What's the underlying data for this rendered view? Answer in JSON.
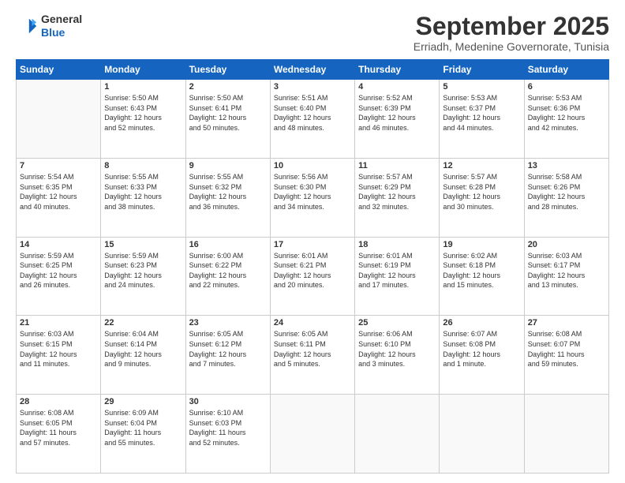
{
  "logo": {
    "line1": "General",
    "line2": "Blue"
  },
  "title": "September 2025",
  "location": "Erriadh, Medenine Governorate, Tunisia",
  "days_of_week": [
    "Sunday",
    "Monday",
    "Tuesday",
    "Wednesday",
    "Thursday",
    "Friday",
    "Saturday"
  ],
  "weeks": [
    [
      {
        "day": "",
        "info": ""
      },
      {
        "day": "1",
        "info": "Sunrise: 5:50 AM\nSunset: 6:43 PM\nDaylight: 12 hours\nand 52 minutes."
      },
      {
        "day": "2",
        "info": "Sunrise: 5:50 AM\nSunset: 6:41 PM\nDaylight: 12 hours\nand 50 minutes."
      },
      {
        "day": "3",
        "info": "Sunrise: 5:51 AM\nSunset: 6:40 PM\nDaylight: 12 hours\nand 48 minutes."
      },
      {
        "day": "4",
        "info": "Sunrise: 5:52 AM\nSunset: 6:39 PM\nDaylight: 12 hours\nand 46 minutes."
      },
      {
        "day": "5",
        "info": "Sunrise: 5:53 AM\nSunset: 6:37 PM\nDaylight: 12 hours\nand 44 minutes."
      },
      {
        "day": "6",
        "info": "Sunrise: 5:53 AM\nSunset: 6:36 PM\nDaylight: 12 hours\nand 42 minutes."
      }
    ],
    [
      {
        "day": "7",
        "info": "Sunrise: 5:54 AM\nSunset: 6:35 PM\nDaylight: 12 hours\nand 40 minutes."
      },
      {
        "day": "8",
        "info": "Sunrise: 5:55 AM\nSunset: 6:33 PM\nDaylight: 12 hours\nand 38 minutes."
      },
      {
        "day": "9",
        "info": "Sunrise: 5:55 AM\nSunset: 6:32 PM\nDaylight: 12 hours\nand 36 minutes."
      },
      {
        "day": "10",
        "info": "Sunrise: 5:56 AM\nSunset: 6:30 PM\nDaylight: 12 hours\nand 34 minutes."
      },
      {
        "day": "11",
        "info": "Sunrise: 5:57 AM\nSunset: 6:29 PM\nDaylight: 12 hours\nand 32 minutes."
      },
      {
        "day": "12",
        "info": "Sunrise: 5:57 AM\nSunset: 6:28 PM\nDaylight: 12 hours\nand 30 minutes."
      },
      {
        "day": "13",
        "info": "Sunrise: 5:58 AM\nSunset: 6:26 PM\nDaylight: 12 hours\nand 28 minutes."
      }
    ],
    [
      {
        "day": "14",
        "info": "Sunrise: 5:59 AM\nSunset: 6:25 PM\nDaylight: 12 hours\nand 26 minutes."
      },
      {
        "day": "15",
        "info": "Sunrise: 5:59 AM\nSunset: 6:23 PM\nDaylight: 12 hours\nand 24 minutes."
      },
      {
        "day": "16",
        "info": "Sunrise: 6:00 AM\nSunset: 6:22 PM\nDaylight: 12 hours\nand 22 minutes."
      },
      {
        "day": "17",
        "info": "Sunrise: 6:01 AM\nSunset: 6:21 PM\nDaylight: 12 hours\nand 20 minutes."
      },
      {
        "day": "18",
        "info": "Sunrise: 6:01 AM\nSunset: 6:19 PM\nDaylight: 12 hours\nand 17 minutes."
      },
      {
        "day": "19",
        "info": "Sunrise: 6:02 AM\nSunset: 6:18 PM\nDaylight: 12 hours\nand 15 minutes."
      },
      {
        "day": "20",
        "info": "Sunrise: 6:03 AM\nSunset: 6:17 PM\nDaylight: 12 hours\nand 13 minutes."
      }
    ],
    [
      {
        "day": "21",
        "info": "Sunrise: 6:03 AM\nSunset: 6:15 PM\nDaylight: 12 hours\nand 11 minutes."
      },
      {
        "day": "22",
        "info": "Sunrise: 6:04 AM\nSunset: 6:14 PM\nDaylight: 12 hours\nand 9 minutes."
      },
      {
        "day": "23",
        "info": "Sunrise: 6:05 AM\nSunset: 6:12 PM\nDaylight: 12 hours\nand 7 minutes."
      },
      {
        "day": "24",
        "info": "Sunrise: 6:05 AM\nSunset: 6:11 PM\nDaylight: 12 hours\nand 5 minutes."
      },
      {
        "day": "25",
        "info": "Sunrise: 6:06 AM\nSunset: 6:10 PM\nDaylight: 12 hours\nand 3 minutes."
      },
      {
        "day": "26",
        "info": "Sunrise: 6:07 AM\nSunset: 6:08 PM\nDaylight: 12 hours\nand 1 minute."
      },
      {
        "day": "27",
        "info": "Sunrise: 6:08 AM\nSunset: 6:07 PM\nDaylight: 11 hours\nand 59 minutes."
      }
    ],
    [
      {
        "day": "28",
        "info": "Sunrise: 6:08 AM\nSunset: 6:05 PM\nDaylight: 11 hours\nand 57 minutes."
      },
      {
        "day": "29",
        "info": "Sunrise: 6:09 AM\nSunset: 6:04 PM\nDaylight: 11 hours\nand 55 minutes."
      },
      {
        "day": "30",
        "info": "Sunrise: 6:10 AM\nSunset: 6:03 PM\nDaylight: 11 hours\nand 52 minutes."
      },
      {
        "day": "",
        "info": ""
      },
      {
        "day": "",
        "info": ""
      },
      {
        "day": "",
        "info": ""
      },
      {
        "day": "",
        "info": ""
      }
    ]
  ]
}
